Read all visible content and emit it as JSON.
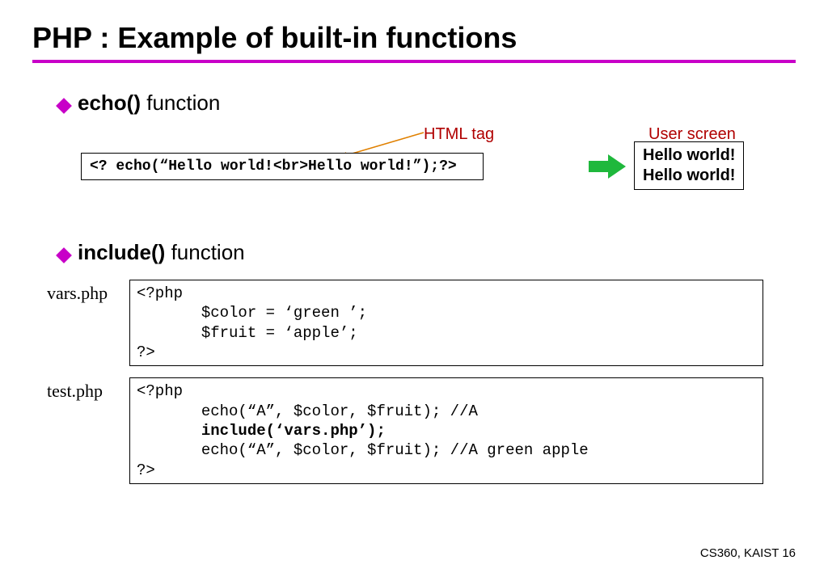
{
  "title": "PHP : Example of built-in functions",
  "bullets": {
    "echo_bold": "echo()",
    "echo_rest": " function",
    "include_bold": "include()",
    "include_rest": " function"
  },
  "labels": {
    "html_tag": "HTML tag",
    "user_screen": "User screen"
  },
  "echo_code": "<? echo(“Hello world!<br>Hello world!”);?>",
  "output": {
    "line1": "Hello world!",
    "line2": "Hello world!"
  },
  "vars_label": "vars.php",
  "test_label": "test.php",
  "vars_code": {
    "l1": "<?php",
    "l2": "       $color = ‘green ’;",
    "l3": "       $fruit = ‘apple’;",
    "l4": "?>"
  },
  "test_code": {
    "l1": "<?php",
    "l2": "       echo(“A”, $color, $fruit); //A",
    "l3": "       include(‘vars.php’);",
    "l4": "       echo(“A”, $color, $fruit); //A green apple",
    "l5": "?>"
  },
  "footer": {
    "course": "CS360, KAIST",
    "page": "16"
  }
}
